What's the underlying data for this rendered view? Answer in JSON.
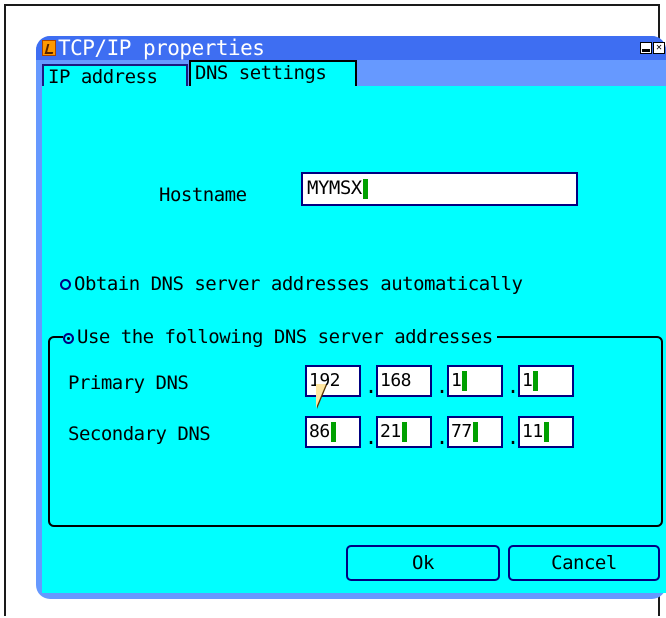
{
  "window": {
    "title": "TCP/IP properties",
    "close_glyph": "✕"
  },
  "tabs": [
    {
      "label": "IP address",
      "active": false
    },
    {
      "label": "DNS settings",
      "active": true
    }
  ],
  "dns": {
    "hostname_label": "Hostname",
    "hostname_value": "MYMSX",
    "radio_auto_label": "Obtain DNS server addresses automatically",
    "radio_manual_label": "Use the following DNS server addresses",
    "selected_radio": "manual",
    "primary_label": "Primary DNS",
    "secondary_label": "Secondary DNS",
    "primary": [
      "192",
      "168",
      "1",
      "1"
    ],
    "secondary": [
      "86",
      "21",
      "77",
      "11"
    ],
    "separator": "."
  },
  "buttons": {
    "ok": "Ok",
    "cancel": "Cancel"
  },
  "colors": {
    "content_bg": "#00ffff",
    "window_border": "#6699ff",
    "titlebar": "#3e6ef2",
    "caret": "#00a000"
  }
}
